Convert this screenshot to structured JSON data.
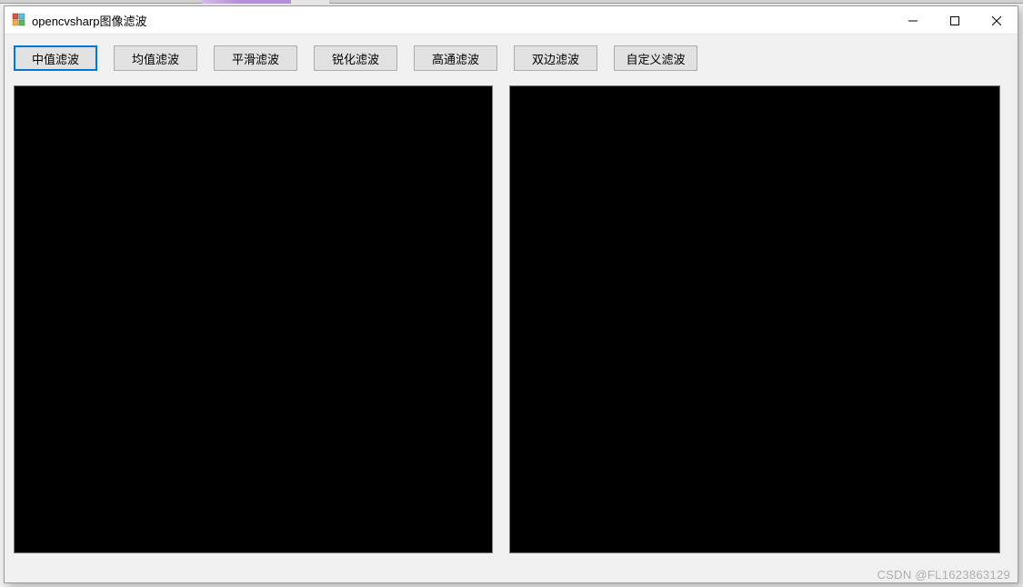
{
  "window": {
    "title": "opencvsharp图像滤波"
  },
  "buttons": {
    "median": "中值滤波",
    "mean": "均值滤波",
    "smooth": "平滑滤波",
    "sharpen": "锐化滤波",
    "highpass": "高通滤波",
    "bilateral": "双边滤波",
    "custom": "自定义滤波"
  },
  "watermark": "CSDN @FL1623863129"
}
